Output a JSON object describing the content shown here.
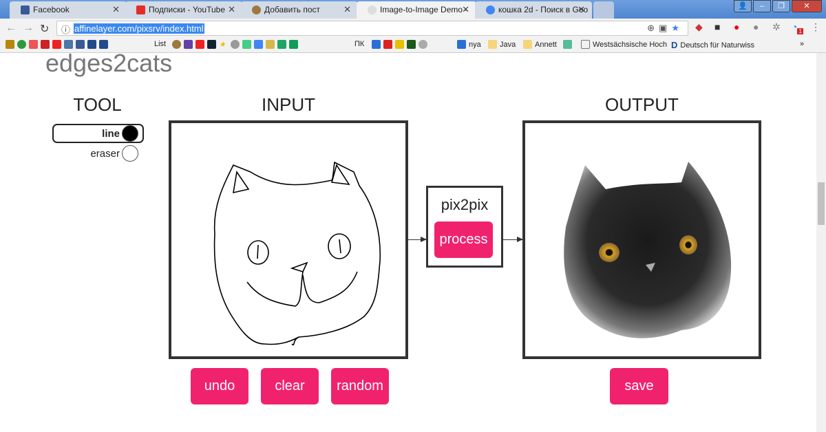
{
  "browser": {
    "tabs": [
      {
        "label": "Facebook",
        "color": "#3b5998"
      },
      {
        "label": "Подписки - YouTube",
        "color": "#e52d27"
      },
      {
        "label": "Добавить пост",
        "color": "#9c7a3c"
      },
      {
        "label": "Image-to-Image Demo -",
        "color": "#bbbbbb"
      },
      {
        "label": "кошка 2d - Поиск в Goo",
        "color": "#4285f4"
      }
    ],
    "url": "affinelayer.com/pixsrv/index.html",
    "bookmarks": [
      {
        "label": "List",
        "color": "#234a8a"
      },
      {
        "label": "ПК",
        "color": "#0f9d58"
      },
      {
        "label": "nya",
        "color": "#2a6fd6"
      },
      {
        "label": "Java",
        "color": "#f6d57a"
      },
      {
        "label": "Annett",
        "color": "#f6d57a"
      },
      {
        "label": "Westsächsische Hoch",
        "color": "#ffffff"
      },
      {
        "label": "Deutsch für Naturwiss",
        "color": "#1a4fa0"
      }
    ],
    "more": "»",
    "ext_badge": "1"
  },
  "page": {
    "title": "edges2cats",
    "tool": {
      "heading": "TOOL",
      "options": [
        {
          "label": "line",
          "selected": true
        },
        {
          "label": "eraser",
          "selected": false
        }
      ]
    },
    "input": {
      "heading": "INPUT",
      "buttons": [
        "undo",
        "clear",
        "random"
      ]
    },
    "model": {
      "label": "pix2pix",
      "button": "process"
    },
    "output": {
      "heading": "OUTPUT",
      "button": "save"
    },
    "accent": "#f0226e"
  }
}
